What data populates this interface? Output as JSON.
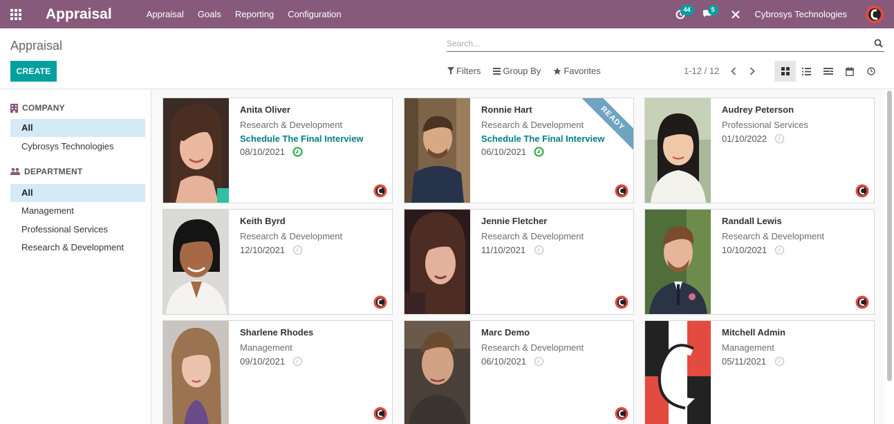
{
  "navbar": {
    "brand": "Appraisal",
    "menu": [
      "Appraisal",
      "Goals",
      "Reporting",
      "Configuration"
    ],
    "activity_count": "44",
    "message_count": "5",
    "company": "Cybrosys Technologies",
    "color": "#875a7b"
  },
  "control_panel": {
    "breadcrumb": "Appraisal",
    "create_label": "CREATE",
    "search_placeholder": "Search...",
    "filters_label": "Filters",
    "group_by_label": "Group By",
    "favorites_label": "Favorites",
    "pager": "1-12 / 12",
    "views": [
      "kanban-icon",
      "list-icon",
      "activity-list-icon",
      "calendar-icon",
      "clock-icon"
    ],
    "active_view": "kanban"
  },
  "sidebar": {
    "company_header": "COMPANY",
    "company_items": [
      "All",
      "Cybrosys Technologies"
    ],
    "department_header": "DEPARTMENT",
    "department_items": [
      "All",
      "Management",
      "Professional Services",
      "Research & Development"
    ],
    "active_color": "#d5eaf7"
  },
  "cards": [
    {
      "name": "Anita Oliver",
      "department": "Research & Development",
      "activity": "Schedule The Final Interview",
      "date": "08/10/2021",
      "clock": "active"
    },
    {
      "name": "Ronnie Hart",
      "department": "Research & Development",
      "activity": "Schedule The Final Interview",
      "date": "06/10/2021",
      "clock": "active",
      "ribbon": "READY"
    },
    {
      "name": "Audrey Peterson",
      "department": "Professional Services",
      "date": "01/10/2022",
      "clock": "inactive"
    },
    {
      "name": "Keith Byrd",
      "department": "Research & Development",
      "date": "12/10/2021",
      "clock": "inactive"
    },
    {
      "name": "Jennie Fletcher",
      "department": "Research & Development",
      "date": "11/10/2021",
      "clock": "inactive"
    },
    {
      "name": "Randall Lewis",
      "department": "Research & Development",
      "date": "10/10/2021",
      "clock": "inactive"
    },
    {
      "name": "Sharlene Rhodes",
      "department": "Management",
      "date": "09/10/2021",
      "clock": "inactive"
    },
    {
      "name": "Marc Demo",
      "department": "Research & Development",
      "date": "06/10/2021",
      "clock": "inactive"
    },
    {
      "name": "Mitchell Admin",
      "department": "Management",
      "date": "05/11/2021",
      "clock": "inactive"
    }
  ],
  "accent": "#00a09d",
  "link_color": "#017e84"
}
